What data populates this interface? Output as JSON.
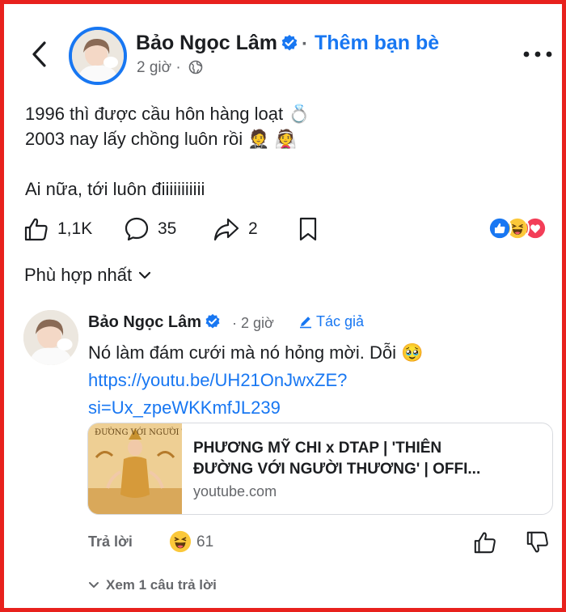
{
  "header": {
    "author_name": "Bảo Ngọc Lâm",
    "separator": "·",
    "add_friend_label": "Thêm bạn bè",
    "timestamp": "2 giờ",
    "meta_dot": "·",
    "privacy_icon": "globe-icon",
    "back_icon": "chevron-left-icon",
    "more_icon": "more-horizontal-icon"
  },
  "post": {
    "lines": [
      "1996 thì được cầu hôn hàng loạt 💍",
      "2003 nay lấy chồng luôn rồi 🤵 👰",
      "Ai nữa, tới luôn điiiiiiiiiii"
    ]
  },
  "actions": {
    "like_count": "1,1K",
    "comment_count": "35",
    "share_count": "2",
    "reactions": [
      "like",
      "haha",
      "love"
    ]
  },
  "sort": {
    "label": "Phù hợp nhất"
  },
  "comment": {
    "author_name": "Bảo Ngọc Lâm",
    "timestamp": "2 giờ",
    "timestamp_prefix": "·",
    "badge_label": "Tác giả",
    "text": "Nó làm đám cưới mà nó hỏng mời. Dỗi 🥹",
    "link_lines": [
      "https://youtu.be/UH21OnJwxZE?",
      "si=Ux_zpeWKKmfJL239"
    ],
    "preview": {
      "title_lines": [
        "PHƯƠNG MỸ CHI x DTAP | 'THIÊN",
        "ĐƯỜNG VỚI NGƯỜI THƯƠNG' | OFFI..."
      ],
      "domain": "youtube.com"
    },
    "reply_label": "Trả lời",
    "reaction_count": "61",
    "view_replies_label": "Xem 1 câu trả lời"
  },
  "colors": {
    "accent": "#1877f2",
    "frame": "#e8211d",
    "secondary_text": "#65676b"
  }
}
